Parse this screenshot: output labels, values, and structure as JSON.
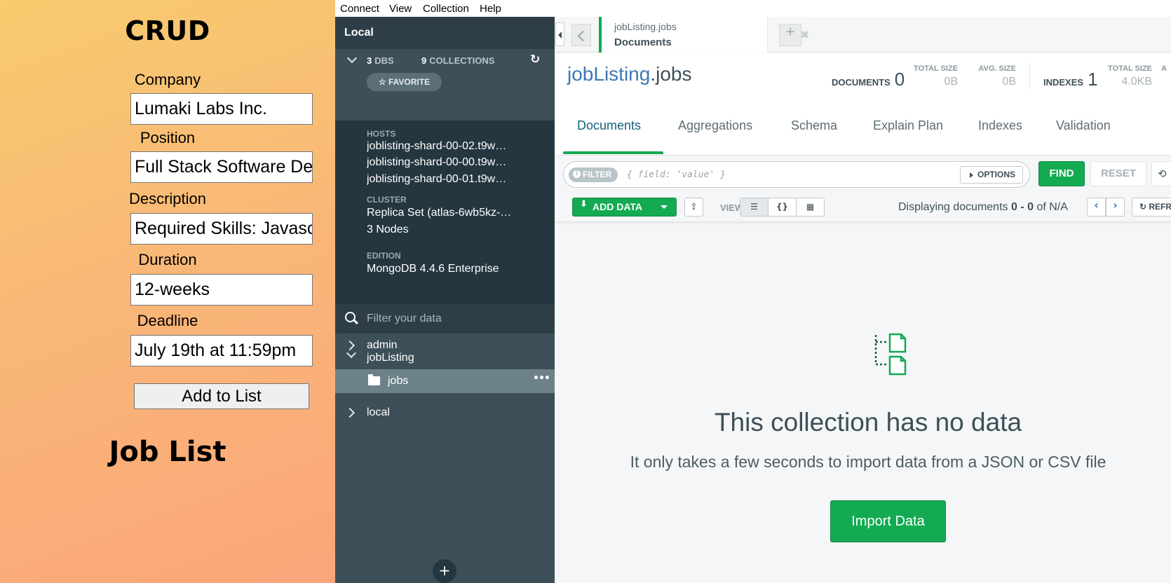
{
  "crud_app": {
    "title": "CRUD",
    "fields": [
      {
        "label": "Company",
        "value": "Lumaki Labs Inc."
      },
      {
        "label": "Position",
        "value": "Full Stack Software Developer"
      },
      {
        "label": "Description",
        "value": "Required Skills: Javascript"
      },
      {
        "label": "Duration",
        "value": "12-weeks"
      },
      {
        "label": "Deadline",
        "value": "July 19th at 11:59pm"
      }
    ],
    "add_button": "Add to List",
    "list_title": "Job List"
  },
  "menubar": {
    "items": [
      "Connect",
      "View",
      "Collection",
      "Help"
    ]
  },
  "sidebar": {
    "header_title": "Local",
    "dbs_count": "3",
    "dbs_label": "DBS",
    "collections_count": "9",
    "collections_label": "COLLECTIONS",
    "favorite_label": "☆ FAVORITE",
    "hosts_label": "HOSTS",
    "hosts": [
      "joblisting-shard-00-02.t9w…",
      "joblisting-shard-00-00.t9w…",
      "joblisting-shard-00-01.t9w…"
    ],
    "cluster_label": "CLUSTER",
    "cluster_value": "Replica Set (atlas-6wb5kz-…",
    "cluster_nodes": "3 Nodes",
    "edition_label": "EDITION",
    "edition_value": "MongoDB 4.4.6 Enterprise",
    "filter_placeholder": "Filter your data",
    "databases": [
      {
        "name": "admin",
        "expanded": false
      },
      {
        "name": "jobListing",
        "expanded": true
      },
      {
        "name": "local",
        "expanded": false
      }
    ],
    "selected_collection": "jobs",
    "ellipsis": "•••",
    "add_button": "+"
  },
  "tab": {
    "namespace": "jobListing.jobs",
    "subtitle": "Documents",
    "close": "✖",
    "new_tab": "+"
  },
  "collection": {
    "db": "jobListing",
    "coll": ".jobs",
    "documents_label": "DOCUMENTS",
    "documents_count": "0",
    "total_size_label": "TOTAL SIZE",
    "total_size": "0B",
    "avg_size_label": "AVG. SIZE",
    "avg_size": "0B",
    "indexes_label": "INDEXES",
    "indexes_count": "1",
    "idx_total_size_label": "TOTAL SIZE",
    "idx_total_size": "4.0KB",
    "idx_avg_label": "A"
  },
  "subtabs": [
    "Documents",
    "Aggregations",
    "Schema",
    "Explain Plan",
    "Indexes",
    "Validation"
  ],
  "query": {
    "filter_label": "FILTER",
    "placeholder": "{ field: 'value' }",
    "options_label": "OPTIONS",
    "find_label": "FIND",
    "reset_label": "RESET",
    "history_icon": "⟲"
  },
  "toolbar": {
    "add_data_label": "ADD DATA",
    "view_label": "VIEW",
    "display_prefix": "Displaying documents",
    "display_range": "0 - 0",
    "display_of": "of N/A",
    "refresh_label": "↻ REFRESH"
  },
  "empty_state": {
    "title": "This collection has no data",
    "subtitle": "It only takes a few seconds to import data from a JSON or CSV file",
    "import_button": "Import Data"
  },
  "colors": {
    "accent_green": "#13aa52",
    "sidebar_bg": "#3d4f58",
    "link_blue": "#3e77b5"
  }
}
